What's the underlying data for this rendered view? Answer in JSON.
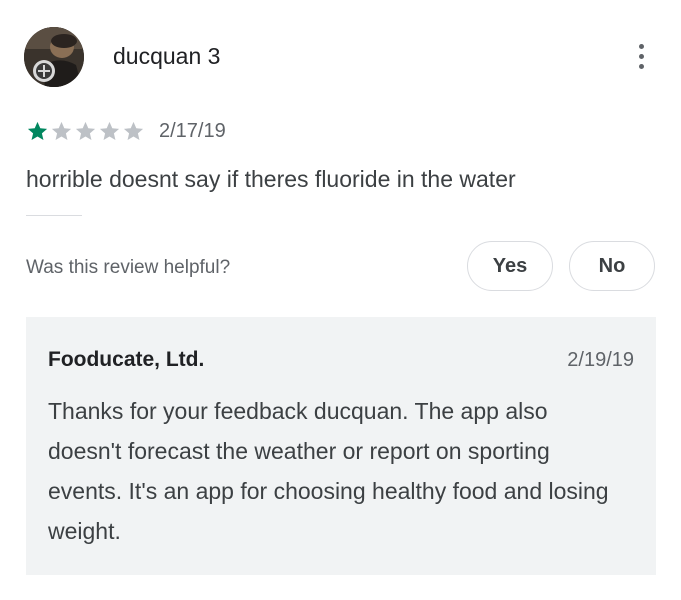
{
  "review": {
    "author": "ducquan 3",
    "rating": 1,
    "max_rating": 5,
    "date": "2/17/19",
    "text": "horrible doesnt say if theres fluoride in the water"
  },
  "helpful": {
    "question": "Was this review helpful?",
    "yes_label": "Yes",
    "no_label": "No"
  },
  "reply": {
    "developer": "Fooducate, Ltd.",
    "date": "2/19/19",
    "text": "Thanks for your feedback ducquan. The app also doesn't forecast the weather or report on sporting events. It's an app for choosing healthy food and losing weight."
  },
  "icons": {
    "avatar": "user-avatar-photo",
    "more": "more-vert-icon",
    "star": "star-icon"
  },
  "colors": {
    "star_filled": "#01875f",
    "star_empty": "#bdc1c6",
    "reply_background": "#f1f3f4"
  }
}
